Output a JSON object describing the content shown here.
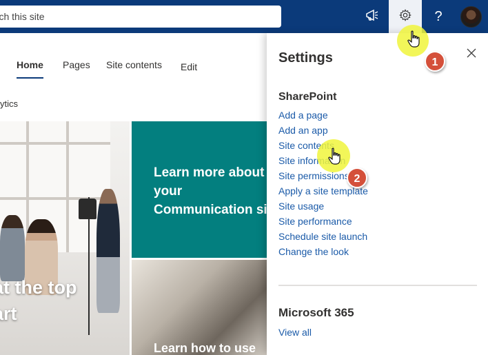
{
  "search": {
    "placeholder": "arch this site",
    "value": ""
  },
  "nav": {
    "home": "Home",
    "pages": "Pages",
    "site_contents": "Site contents",
    "edit": "Edit",
    "analytics": "ytics"
  },
  "hero": {
    "photo_line1": "at the top",
    "photo_line2": "art",
    "teal_line1": "Learn more about",
    "teal_line2": "your",
    "teal_line3": "Communication si",
    "arch_line1": "Learn how to use"
  },
  "settings": {
    "title": "Settings",
    "sharepoint_heading": "SharePoint",
    "items": [
      "Add a page",
      "Add an app",
      "Site contents",
      "Site information",
      "Site permissions",
      "Apply a site template",
      "Site usage",
      "Site performance",
      "Schedule site launch",
      "Change the look"
    ],
    "m365_heading": "Microsoft 365",
    "view_all": "View all"
  },
  "annotations": {
    "step1": "1",
    "step2": "2"
  },
  "icons": [
    "megaphone-icon",
    "gear-icon",
    "help-icon",
    "close-icon",
    "hand-cursor-icon"
  ],
  "colors": {
    "suite_bar": "#0b3a7a",
    "teal_tile": "#037f7f",
    "link": "#1a5aa8",
    "badge": "#d4503a",
    "highlight": "#f0f53c"
  }
}
